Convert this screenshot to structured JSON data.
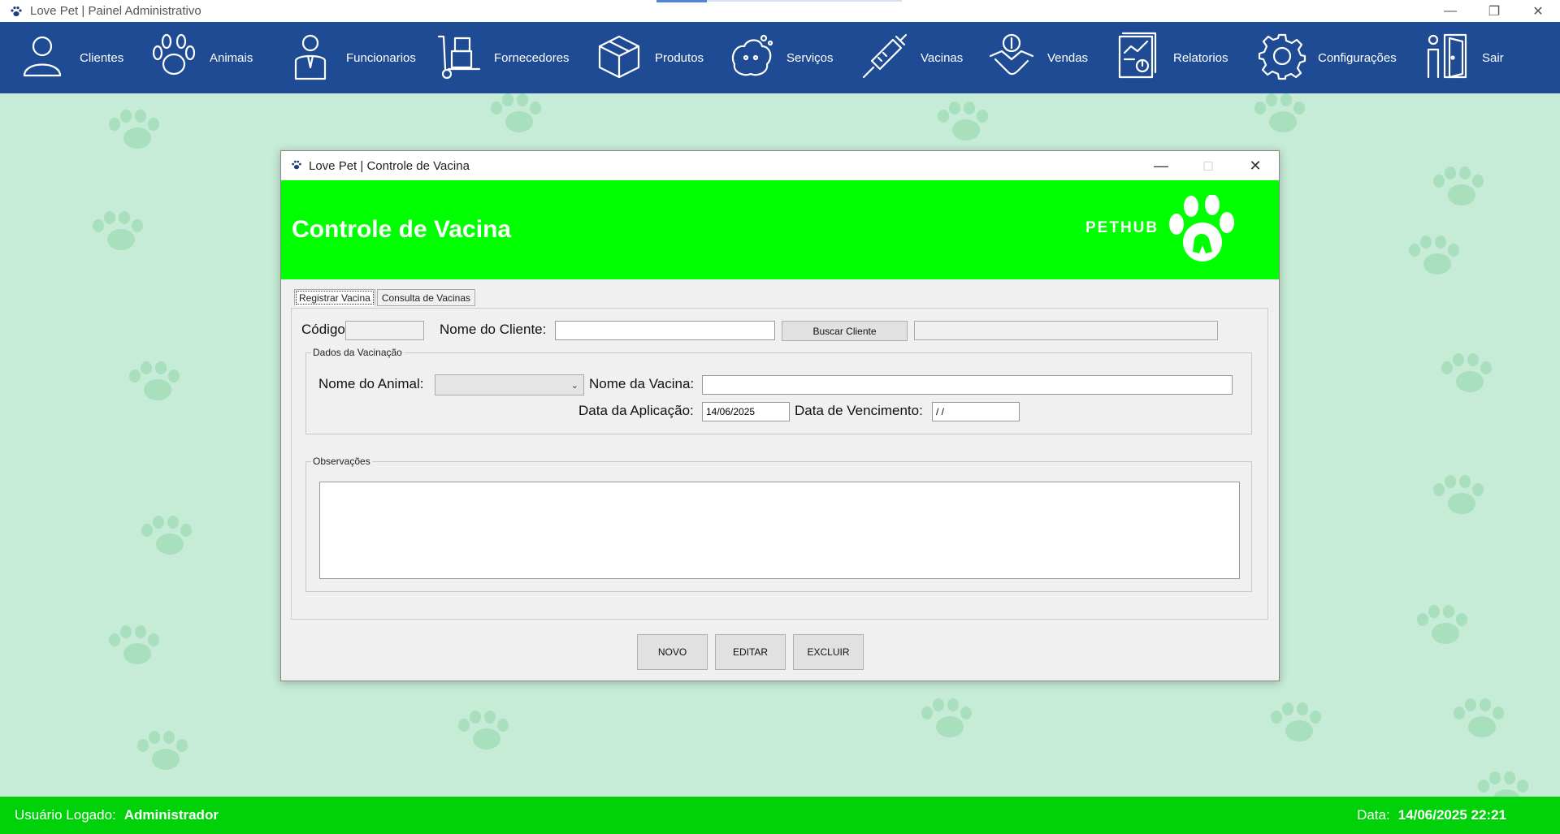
{
  "window": {
    "title": "Love Pet | Painel Administrativo",
    "icon": "paw-icon",
    "controls": [
      "minimize",
      "restore",
      "close"
    ]
  },
  "nav": {
    "items": [
      {
        "label": "Clientes",
        "icon": "user-icon"
      },
      {
        "label": "Animais",
        "icon": "paw-icon"
      },
      {
        "label": "Funcionarios",
        "icon": "employee-icon"
      },
      {
        "label": "Fornecedores",
        "icon": "hand-truck-icon"
      },
      {
        "label": "Produtos",
        "icon": "box-icon"
      },
      {
        "label": "Serviços",
        "icon": "dog-bath-icon"
      },
      {
        "label": "Vacinas",
        "icon": "syringe-icon"
      },
      {
        "label": "Vendas",
        "icon": "handshake-icon"
      },
      {
        "label": "Relatorios",
        "icon": "report-icon"
      },
      {
        "label": "Configurações",
        "icon": "gear-icon"
      },
      {
        "label": "Sair",
        "icon": "exit-door-icon"
      }
    ]
  },
  "status": {
    "user_label": "Usuário Logado:",
    "user_value": "Administrador",
    "date_label": "Data:",
    "date_value": "14/06/2025 22:21"
  },
  "dialog": {
    "title": "Love Pet | Controle de Vacina",
    "banner_title": "Controle de Vacina",
    "logo_text": "PETHUB",
    "tabs": [
      {
        "label": "Registrar Vacina",
        "active": true
      },
      {
        "label": "Consulta de Vacinas",
        "active": false
      }
    ],
    "form": {
      "codigo_label": "Código:",
      "codigo_value": "",
      "cliente_label": "Nome do Cliente:",
      "cliente_value": "",
      "buscar_label": "Buscar Cliente",
      "cliente_result": "",
      "group_vacinacao": "Dados da Vacinação",
      "animal_label": "Nome do Animal:",
      "animal_value": "",
      "vacina_label": "Nome da Vacina:",
      "vacina_value": "",
      "aplicacao_label": "Data da Aplicação:",
      "aplicacao_value": "14/06/2025",
      "vencimento_label": "Data de Vencimento:",
      "vencimento_value": " /  /",
      "group_obs": "Observações",
      "obs_value": ""
    },
    "buttons": {
      "novo": "NOVO",
      "editar": "EDITAR",
      "excluir": "EXCLUIR"
    }
  },
  "colors": {
    "navbar": "#1e4b94",
    "banner": "#00ff00",
    "statusbar": "#00d20a",
    "background": "#c6ebd6"
  }
}
